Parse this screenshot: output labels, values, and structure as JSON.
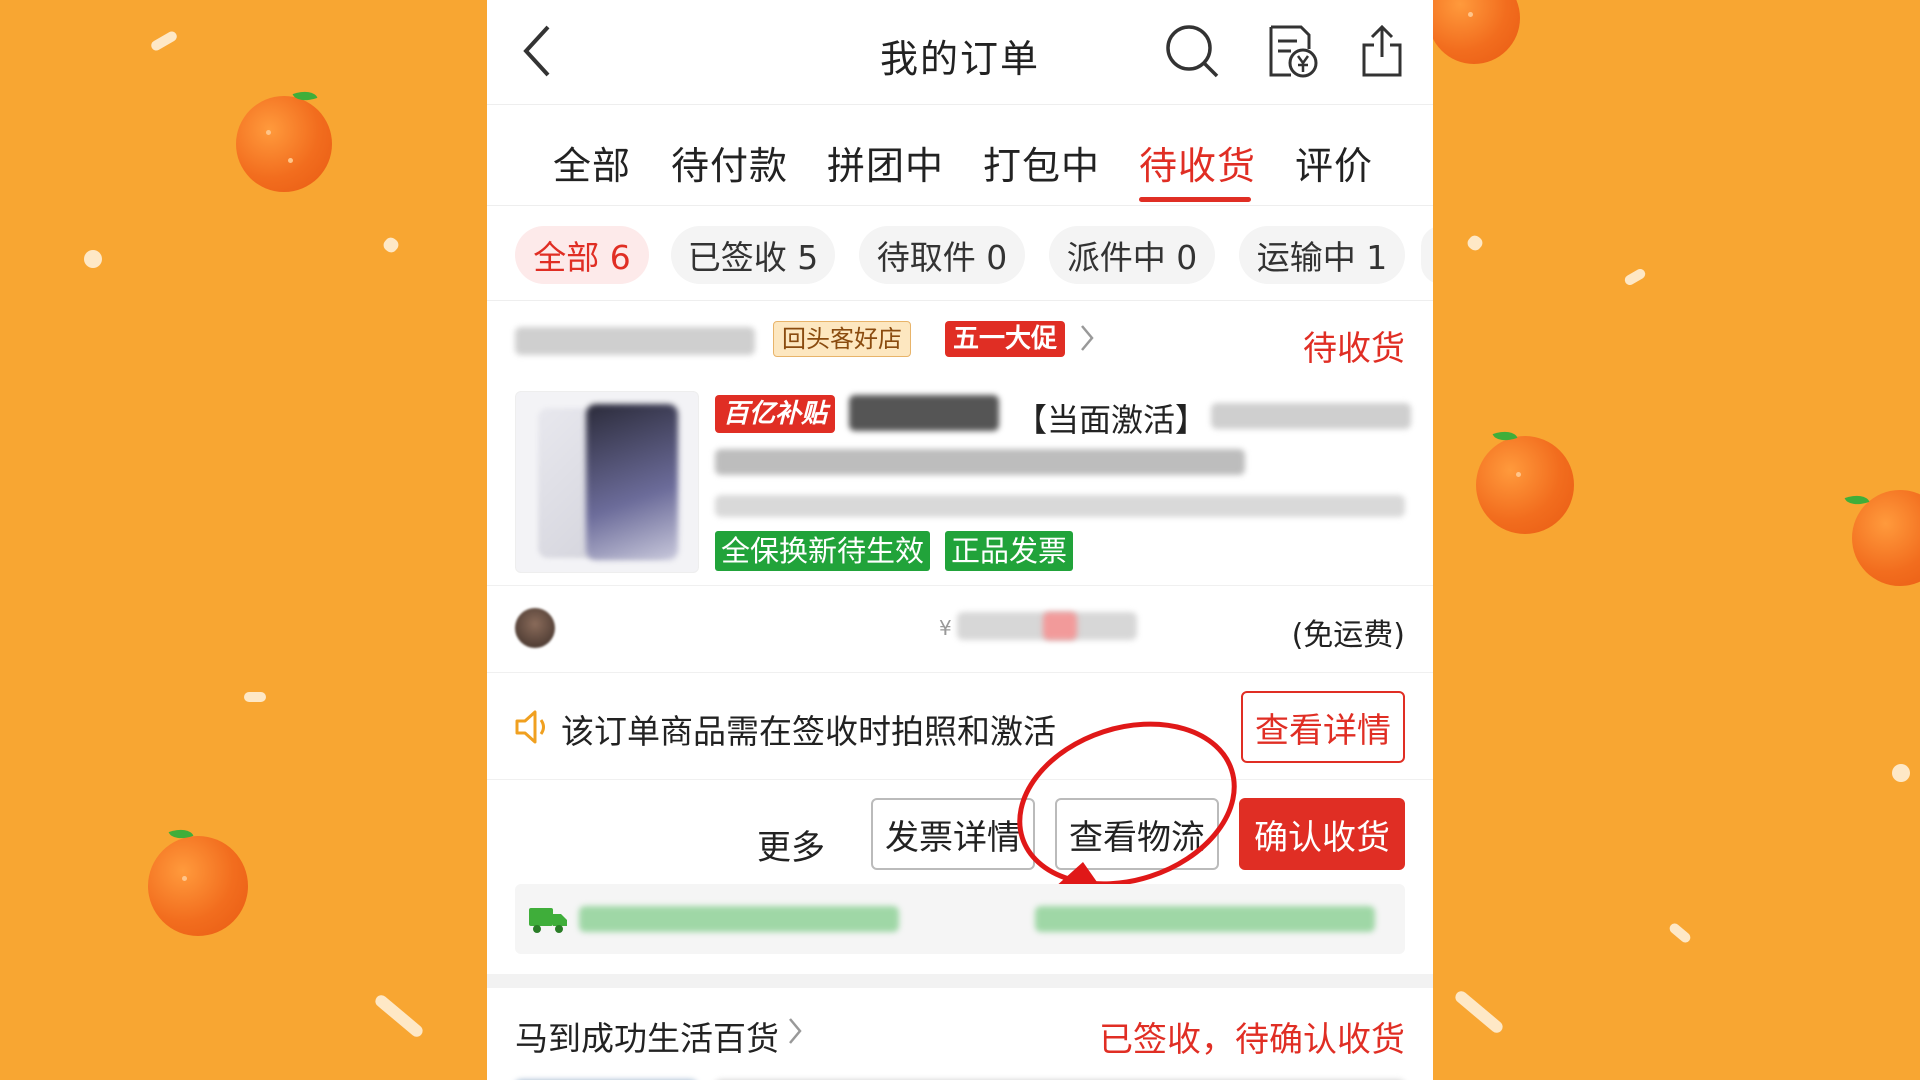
{
  "header": {
    "title": "我的订单"
  },
  "tabs": [
    {
      "label": "全部"
    },
    {
      "label": "待付款"
    },
    {
      "label": "拼团中"
    },
    {
      "label": "打包中"
    },
    {
      "label": "待收货"
    },
    {
      "label": "评价"
    }
  ],
  "chips": [
    {
      "label": "全部 6"
    },
    {
      "label": "已签收 5"
    },
    {
      "label": "待取件 0"
    },
    {
      "label": "派件中 0"
    },
    {
      "label": "运输中 1"
    }
  ],
  "order1": {
    "badge_return": "回头客好店",
    "badge_promo": "五一大促",
    "status": "待收货",
    "product_tag": "百亿补贴",
    "product_title": "【当面激活】",
    "guarantee_tags": [
      "全保换新待生效",
      "正品发票"
    ],
    "shipping_note": "(免运费)",
    "currency_symbol": "¥",
    "notice": "该订单商品需在签收时拍照和激活",
    "detail_button": "查看详情",
    "more_label": "更多",
    "invoice_button": "发票详情",
    "logistics_button": "查看物流",
    "confirm_button": "确认收货"
  },
  "order2": {
    "shop_name": "马到成功生活百货",
    "status": "已签收，待确认收货"
  }
}
